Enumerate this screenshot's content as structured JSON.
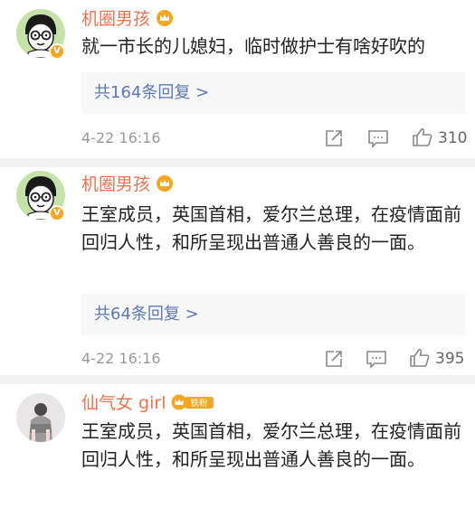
{
  "comments": [
    {
      "username": "机圈男孩",
      "text": "就一市长的儿媳妇，临时做护士有啥好吹的",
      "replies_label": "共164条回复 >",
      "time": "4-22 16:16",
      "likes": "310"
    },
    {
      "username": "机圈男孩",
      "text": "王室成员，英国首相，爱尔兰总理，在疫情面前回归人性，和所呈现出普通人善良的一面。",
      "replies_label": "共64条回复 >",
      "time": "4-22 16:16",
      "likes": "395"
    },
    {
      "username": "仙气女 girl",
      "fan_badge": "铁粉",
      "text": "王室成员，英国首相，爱尔兰总理，在疫情面前回归人性，和所呈现出普通人善良的一面。"
    }
  ],
  "icons": {
    "share": "share-icon",
    "comment": "comment-icon",
    "like": "thumbs-up-icon",
    "crown": "crown-badge-icon",
    "verified": "verified-v-icon"
  },
  "colors": {
    "username": "#eb7350",
    "replies_link": "#5b79b3",
    "badge": "#f5a623"
  }
}
